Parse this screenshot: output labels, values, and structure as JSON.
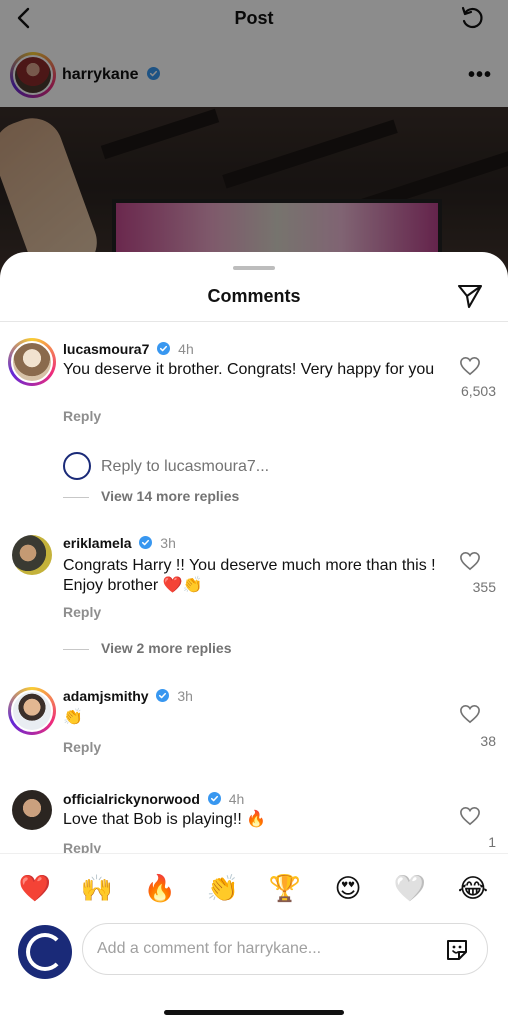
{
  "header": {
    "title": "Post",
    "back_icon": "chevron-left-icon",
    "refresh_icon": "refresh-icon"
  },
  "post": {
    "author": "harrykane",
    "verified": true
  },
  "sheet": {
    "title": "Comments",
    "share_icon": "paper-plane-icon"
  },
  "comments": [
    {
      "username": "lucasmoura7",
      "time": "4h",
      "text": "You deserve it brother. Congrats! Very happy for you",
      "reply_label": "Reply",
      "likes": "6,503",
      "reply_prompt": "Reply to lucasmoura7...",
      "view_more": "View 14 more replies"
    },
    {
      "username": "eriklamela",
      "time": "3h",
      "text": "Congrats Harry !! You deserve much more than this ! Enjoy brother ❤️👏",
      "reply_label": "Reply",
      "likes": "355",
      "view_more": "View 2 more replies"
    },
    {
      "username": "adamjsmithy",
      "time": "3h",
      "text": "👏",
      "reply_label": "Reply",
      "likes": "38"
    },
    {
      "username": "officialrickynorwood",
      "time": "4h",
      "text": "Love that Bob is playing!! 🔥",
      "reply_label": "Reply",
      "likes": "1"
    }
  ],
  "quick_reactions": [
    "❤️",
    "🙌",
    "🔥",
    "👏",
    "🏆",
    "😍",
    "🤍",
    "😂"
  ],
  "composer": {
    "placeholder": "Add a comment for harrykane...",
    "value": "",
    "sticker_icon": "sticker-icon"
  },
  "colors": {
    "verified_blue": "#3897f0",
    "muted_text": "#8e8e8e",
    "heart_red": "#ed4956"
  }
}
